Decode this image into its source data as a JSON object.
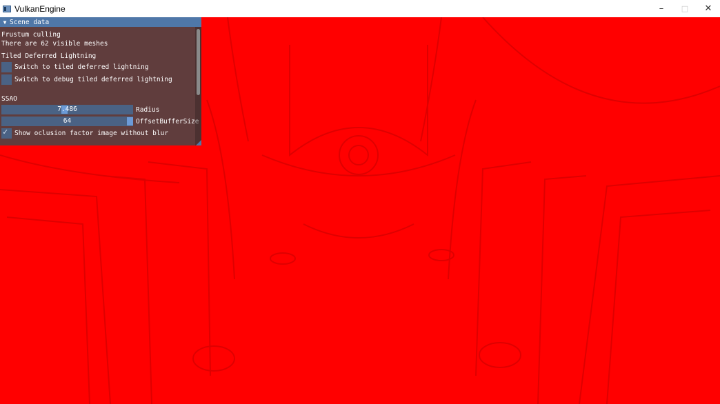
{
  "window": {
    "title": "VulkanEngine",
    "controls": {
      "minimize": "–",
      "maximize": "□",
      "close": "✕"
    }
  },
  "panel": {
    "title": "Scene data",
    "frustum": {
      "heading": "Frustum culling",
      "visible_text": "There are 62 visible meshes"
    },
    "tiled": {
      "heading": "Tiled Deferred Lightning",
      "checkboxes": [
        {
          "label": "Switch to tiled deferred lightning",
          "checked": false
        },
        {
          "label": "Switch to debug tiled deferred lightning",
          "checked": false
        }
      ]
    },
    "ssao": {
      "heading": "SSAO",
      "sliders": [
        {
          "label": "Radius",
          "value": "7.486",
          "fraction": 0.48
        },
        {
          "label": "OffsetBufferSize",
          "value": "64",
          "fraction": 1.0
        }
      ],
      "blur_checkbox": {
        "label": "Show oclusion factor image without blur",
        "checked": true
      }
    }
  },
  "colors": {
    "viewport_background": "#ff0000",
    "panel_accent": "#4f77a8",
    "widget_background": "#4a6284"
  },
  "icons": [
    "app-icon",
    "collapse-arrow-icon",
    "checkmark-icon",
    "minimize-icon",
    "maximize-icon",
    "close-icon"
  ]
}
